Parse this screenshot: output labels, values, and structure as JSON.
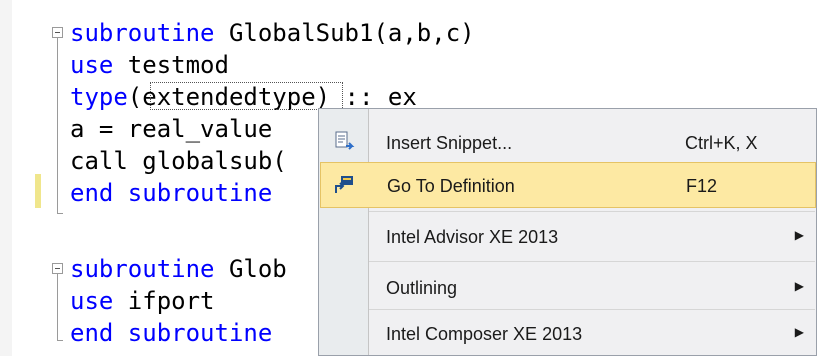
{
  "editor": {
    "lines": [
      {
        "kw": "subroutine",
        "rest": " GlobalSub1(a,b,c)"
      },
      {
        "kw": "use",
        "rest": " testmod"
      },
      {
        "kw": "type",
        "rest": "(extendedtype) :: ex"
      },
      {
        "kw": "",
        "rest": "a = real_value"
      },
      {
        "kw": "",
        "rest": "call globalsub("
      },
      {
        "kw": "end subroutine",
        "rest": ""
      },
      {
        "kw": "subroutine",
        "rest": " Glob"
      },
      {
        "kw": "use",
        "rest": " ifport"
      },
      {
        "kw": "end subroutine",
        "rest": ""
      }
    ]
  },
  "context_menu": {
    "items": [
      {
        "label": "Insert Snippet...",
        "shortcut": "Ctrl+K, X",
        "icon": "insert-snippet-icon"
      },
      {
        "label": "Go To Definition",
        "shortcut": "F12",
        "icon": "go-to-definition-icon",
        "highlighted": true
      },
      {
        "label": "Intel Advisor XE 2013",
        "submenu": true
      },
      {
        "label": "Outlining",
        "submenu": true
      },
      {
        "label": "Intel Composer XE 2013",
        "submenu": true
      }
    ],
    "submenu_arrow": "▶"
  },
  "colors": {
    "keyword": "#0000ff",
    "highlight": "#fde9a3",
    "change_marker": "#f0e68c"
  }
}
